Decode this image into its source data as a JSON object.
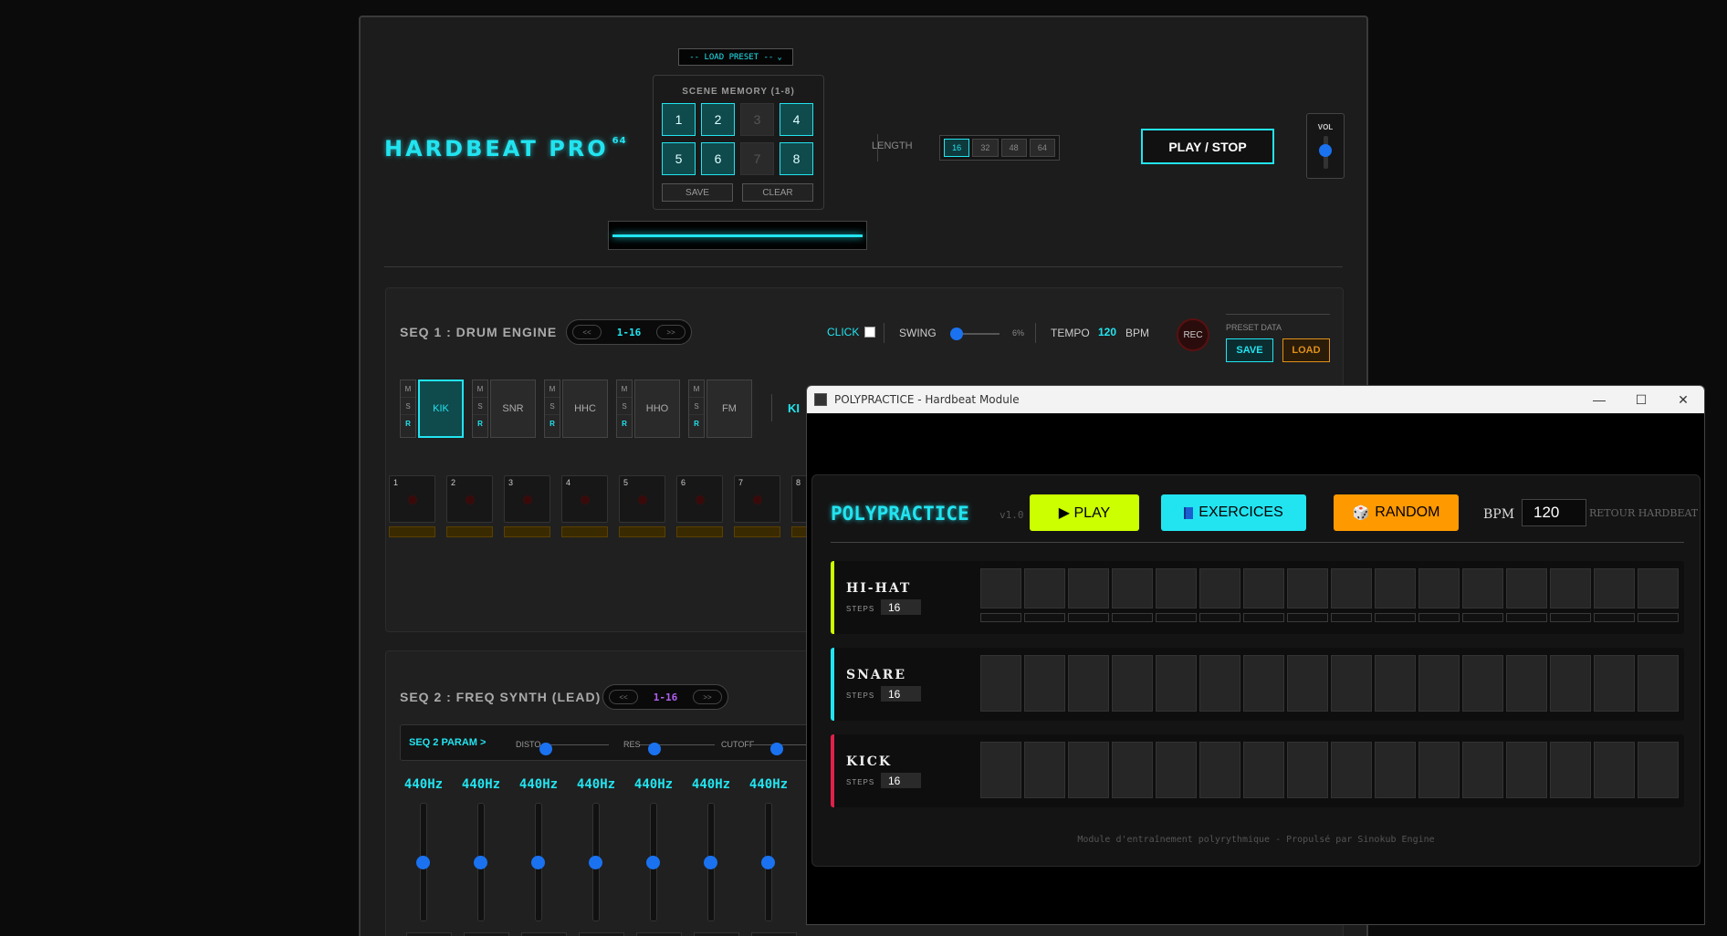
{
  "main": {
    "title": "HARDBEAT PRO",
    "title_sup": "64",
    "preset_select": "-- LOAD PRESET --",
    "scene": {
      "label": "SCENE MEMORY (1-8)",
      "slots": [
        "1",
        "2",
        "3",
        "4",
        "5",
        "6",
        "7",
        "8"
      ],
      "save": "SAVE",
      "clear": "CLEAR"
    },
    "length": {
      "label": "LENGTH",
      "options": [
        "16",
        "32",
        "48",
        "64"
      ],
      "selected": "16"
    },
    "play": "PLAY / STOP",
    "vol": "VOL",
    "seq1": {
      "title": "SEQ 1 : DRUM ENGINE",
      "prev": "<<",
      "range": "1-16",
      "next": ">>",
      "click": "CLICK",
      "swing": "SWING",
      "swing_val": "6%",
      "tempo": "TEMPO",
      "tempo_val": "120",
      "bpm": "BPM",
      "rec": "REC",
      "preset_data": "PRESET DATA",
      "save": "SAVE",
      "load": "LOAD",
      "msr": [
        "M",
        "S",
        "R"
      ],
      "instruments": [
        "KIK",
        "SNR",
        "HHC",
        "HHO",
        "FM"
      ],
      "inst_extra": "KI",
      "steps": [
        "1",
        "2",
        "3",
        "4",
        "5",
        "6",
        "7",
        "8"
      ]
    },
    "seq2": {
      "title": "SEQ 2 : FREQ SYNTH (LEAD)",
      "prev": "<<",
      "range": "1-16",
      "next": ">>",
      "param": "SEQ 2 PARAM >",
      "disto": "DISTO",
      "res": "RES",
      "cutoff": "CUTOFF",
      "freqs": [
        "440Hz",
        "440Hz",
        "440Hz",
        "440Hz",
        "440Hz",
        "440Hz",
        "440Hz"
      ]
    }
  },
  "popup": {
    "window_title": "POLYPRACTICE - Hardbeat Module",
    "title": "POLYPRACTICE",
    "version": "v1.0",
    "play": "▶ PLAY",
    "exercices": "EXERCICES",
    "random": "RANDOM",
    "bpm_label": "BPM",
    "bpm_value": "120",
    "back": "RETOUR HARDBEAT",
    "steps_label": "STEPS",
    "tracks": [
      {
        "name": "HI-HAT",
        "steps": "16"
      },
      {
        "name": "SNARE",
        "steps": "16"
      },
      {
        "name": "KICK",
        "steps": "16"
      }
    ],
    "footer": "Module d'entraînement polyrythmique - Propulsé par Sinokub Engine"
  },
  "colors": {
    "accent_cyan": "#22e4f0",
    "play_green": "#ccff00",
    "random_orange": "#ff9900",
    "hihat": "#ccff00",
    "snare": "#22e4f0",
    "kick": "#e0204a"
  }
}
